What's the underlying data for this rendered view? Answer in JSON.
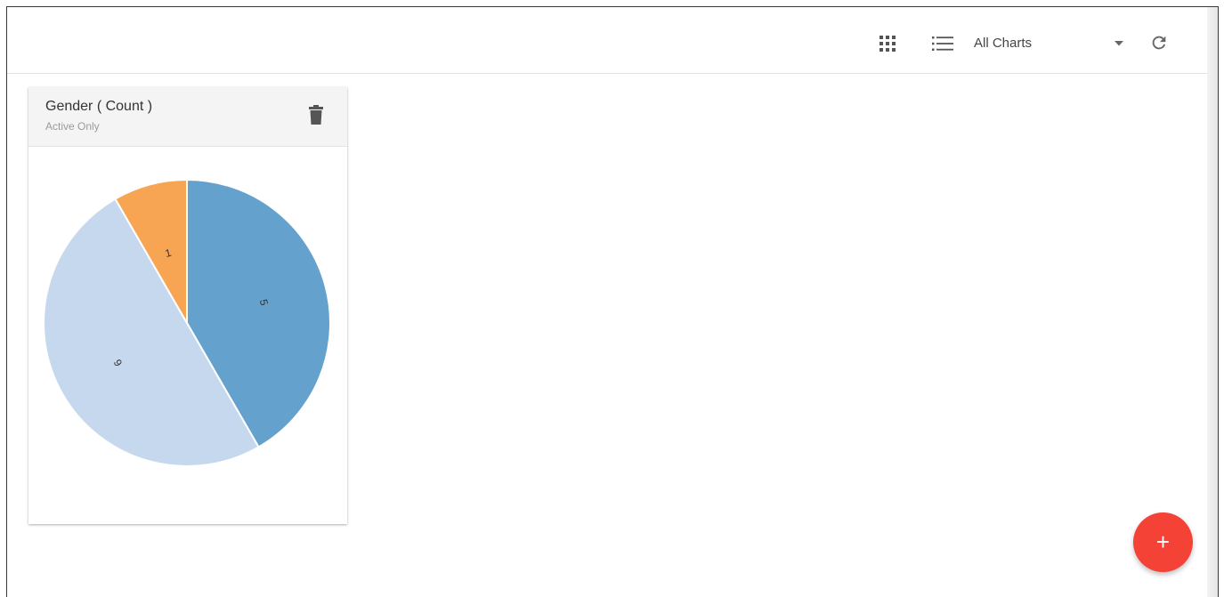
{
  "toolbar": {
    "view_grid_icon": "grid-view-icon",
    "view_list_icon": "list-view-icon",
    "chart_filter": {
      "selected": "All Charts"
    },
    "dropdown_icon": "caret-down-icon",
    "refresh_icon": "refresh-icon"
  },
  "card": {
    "title": "Gender ( Count )",
    "subtitle": "Active Only",
    "delete_icon": "trash-icon"
  },
  "chart_data": {
    "type": "pie",
    "values": [
      5,
      6,
      1
    ],
    "labels": [
      "5",
      "6",
      "1"
    ],
    "colors": [
      "#64a1cc",
      "#c6d8ee",
      "#f7a552"
    ],
    "start": "12 o'clock",
    "direction": "clockwise"
  },
  "fab": {
    "label": "+"
  },
  "colors": {
    "fab": "#f44336",
    "toolbar_icons": "#555555"
  }
}
